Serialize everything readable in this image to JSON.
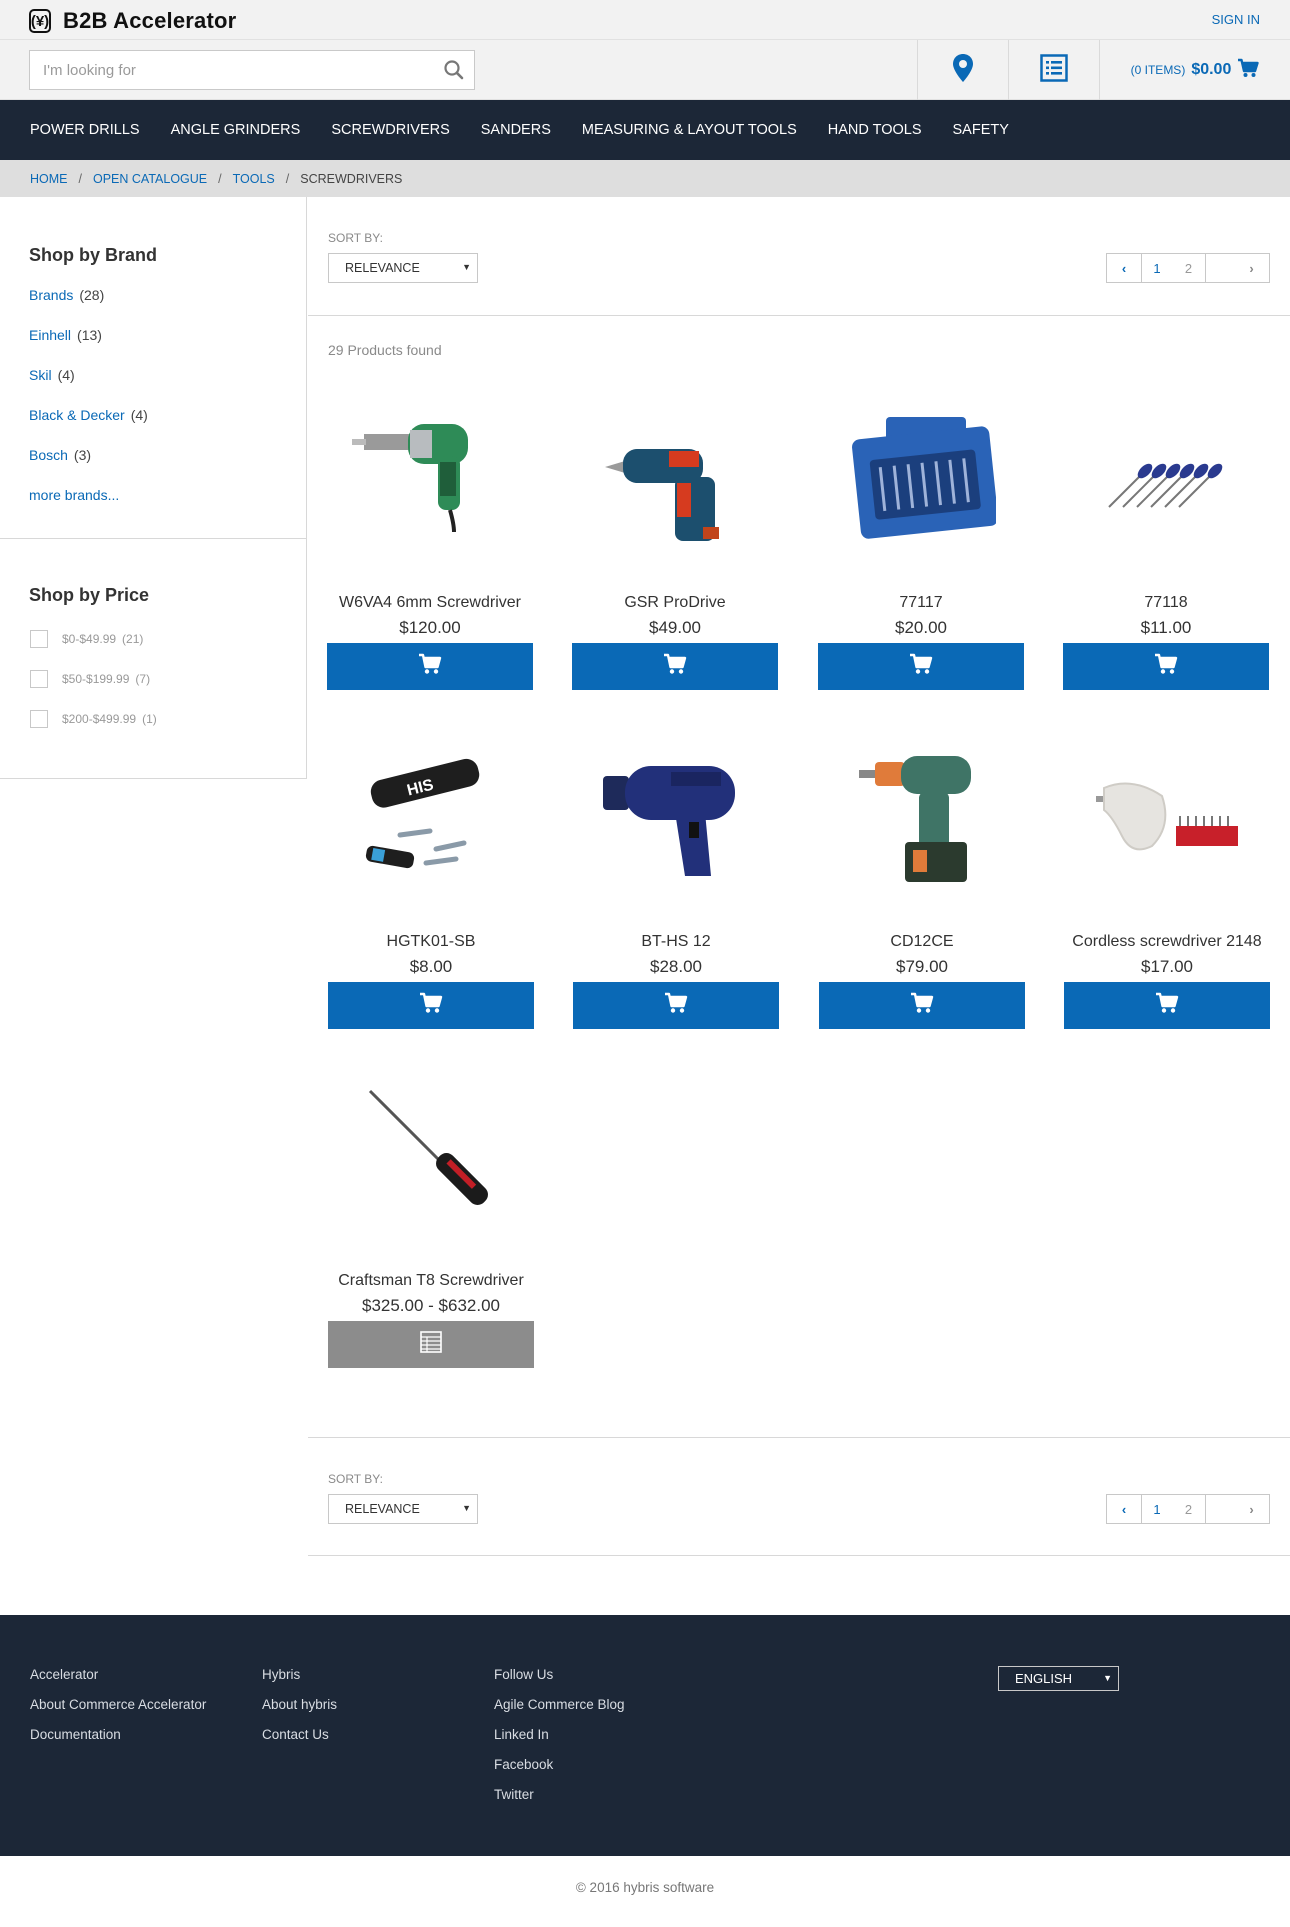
{
  "header": {
    "logo_mark": "(¥)",
    "logo_text": "B2B Accelerator",
    "sign_in": "SIGN IN"
  },
  "search": {
    "placeholder": "I'm looking for",
    "value": ""
  },
  "cart": {
    "items": "(0 ITEMS)",
    "total": "$0.00"
  },
  "nav": [
    "POWER DRILLS",
    "ANGLE GRINDERS",
    "SCREWDRIVERS",
    "SANDERS",
    "MEASURING & LAYOUT TOOLS",
    "HAND TOOLS",
    "SAFETY"
  ],
  "breadcrumb": {
    "home": "HOME",
    "catalogue": "OPEN CATALOGUE",
    "tools": "TOOLS",
    "current": "SCREWDRIVERS",
    "separator": "/"
  },
  "facets": {
    "brand_title": "Shop by Brand",
    "brands": [
      {
        "name": "Brands",
        "count": "(28)"
      },
      {
        "name": "Einhell",
        "count": "(13)"
      },
      {
        "name": "Skil",
        "count": "(4)"
      },
      {
        "name": "Black & Decker",
        "count": "(4)"
      },
      {
        "name": "Bosch",
        "count": "(3)"
      }
    ],
    "more_brands": "more brands...",
    "price_title": "Shop by Price",
    "prices": [
      {
        "range": "$0-$49.99",
        "count": "(21)"
      },
      {
        "range": "$50-$199.99",
        "count": "(7)"
      },
      {
        "range": "$200-$499.99",
        "count": "(1)"
      }
    ]
  },
  "sort": {
    "label": "SORT BY:",
    "value": "RELEVANCE"
  },
  "pagination": {
    "page1": "1",
    "page2": "2",
    "prev": "‹",
    "next": "›"
  },
  "results_text": "29 Products found",
  "products": [
    {
      "name": "W6VA4 6mm Screwdriver",
      "price": "$120.00",
      "image": "drywall-screwdriver-green",
      "action": "add-to-cart"
    },
    {
      "name": "GSR ProDrive",
      "price": "$49.00",
      "image": "cordless-screwdriver-blue-red",
      "action": "add-to-cart"
    },
    {
      "name": "77117",
      "price": "$20.00",
      "image": "screwdriver-set-blue-case",
      "action": "add-to-cart"
    },
    {
      "name": "77118",
      "price": "$11.00",
      "image": "screwdriver-set-six",
      "action": "add-to-cart"
    },
    {
      "name": "HGTK01-SB",
      "price": "$8.00",
      "image": "bit-set-black",
      "action": "add-to-cart"
    },
    {
      "name": "BT-HS 12",
      "price": "$28.00",
      "image": "heat-gun-blue",
      "action": "add-to-cart"
    },
    {
      "name": "CD12CE",
      "price": "$79.00",
      "image": "cordless-drill-green",
      "action": "add-to-cart"
    },
    {
      "name": "Cordless screwdriver 2148",
      "price": "$17.00",
      "image": "cordless-screwdriver-white",
      "action": "add-to-cart"
    },
    {
      "name": "Craftsman T8 Screwdriver",
      "price": "$325.00 - $632.00",
      "image": "screwdriver-red-handle",
      "action": "view-variants"
    }
  ],
  "footer": {
    "col1": [
      "Accelerator",
      "About Commerce Accelerator",
      "Documentation"
    ],
    "col2": [
      "Hybris",
      "About hybris",
      "Contact Us"
    ],
    "col3": [
      "Follow Us",
      "Agile Commerce Blog",
      "Linked In",
      "Facebook",
      "Twitter"
    ],
    "language": "ENGLISH",
    "copyright": "© 2016 hybris software"
  },
  "colors": {
    "accent": "#0a69b6",
    "nav_bg": "#1c2737",
    "breadcrumb_bg": "#dedede",
    "disabled_button": "#8c8c8c"
  }
}
